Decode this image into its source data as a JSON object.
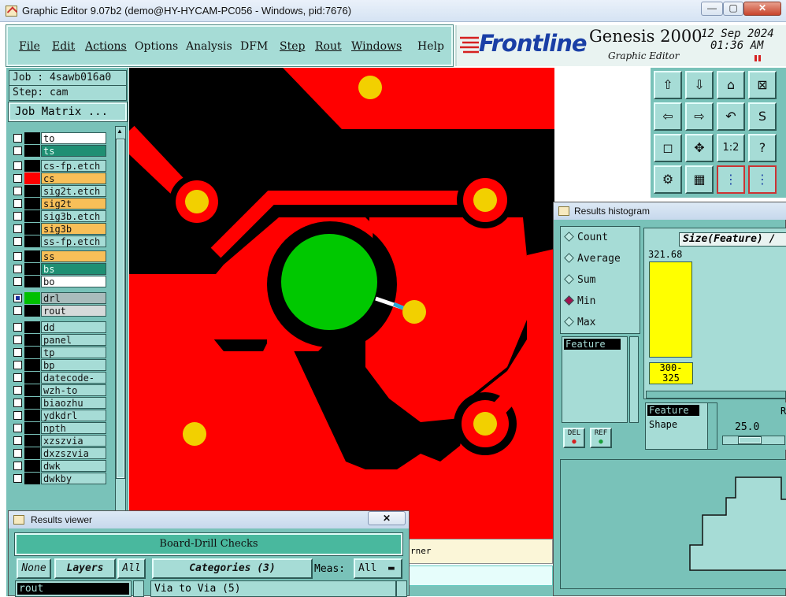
{
  "window": {
    "title": "Graphic Editor 9.07b2 (demo@HY-HYCAM-PC056 - Windows, pid:7676)",
    "min": "—",
    "max": "▢",
    "close": "✕"
  },
  "menu": [
    "File",
    "Edit",
    "Actions",
    "Options",
    "Analysis",
    "DFM",
    "Step",
    "Rout",
    "Windows",
    "Help"
  ],
  "brand": {
    "logo": "Frontline",
    "product": "Genesis 2000",
    "subtitle": "Graphic Editor",
    "date": "12 Sep 2024",
    "time": "01:36 AM"
  },
  "job": {
    "job_label": "Job : 4sawb016a0",
    "step_label": "Step: cam",
    "matrix_button": "Job Matrix ..."
  },
  "layers": [
    {
      "name": "to",
      "color": "#ffffff",
      "swatch": "#000000"
    },
    {
      "name": "ts",
      "color": "#1f8f73",
      "swatch": "#000000"
    },
    {
      "name": "cs-fp.etch",
      "color": "#a6dcd6",
      "swatch": "#000000"
    },
    {
      "name": "cs",
      "color": "#f8bf58",
      "swatch": "#ff0000"
    },
    {
      "name": "sig2t.etch",
      "color": "#a6dcd6",
      "swatch": "#000000"
    },
    {
      "name": "sig2t",
      "color": "#f8bf58",
      "swatch": "#000000"
    },
    {
      "name": "sig3b.etch",
      "color": "#a6dcd6",
      "swatch": "#000000"
    },
    {
      "name": "sig3b",
      "color": "#f8bf58",
      "swatch": "#000000"
    },
    {
      "name": "ss-fp.etch",
      "color": "#a6dcd6",
      "swatch": "#000000"
    },
    {
      "name": "ss",
      "color": "#f8bf58",
      "swatch": "#000000"
    },
    {
      "name": "bs",
      "color": "#1f8f73",
      "swatch": "#000000"
    },
    {
      "name": "bo",
      "color": "#ffffff",
      "swatch": "#000000"
    },
    {
      "name": "drl",
      "color": "#a9bcbc",
      "swatch": "#00c000"
    },
    {
      "name": "rout",
      "color": "#d6dada",
      "swatch": "#000000"
    },
    {
      "name": "dd",
      "color": "#a6dcd6",
      "swatch": "#000000"
    },
    {
      "name": "panel",
      "color": "#a6dcd6",
      "swatch": "#000000"
    },
    {
      "name": "tp",
      "color": "#a6dcd6",
      "swatch": "#000000"
    },
    {
      "name": "bp",
      "color": "#a6dcd6",
      "swatch": "#000000"
    },
    {
      "name": "datecode-to",
      "color": "#a6dcd6",
      "swatch": "#000000"
    },
    {
      "name": "wzh-to",
      "color": "#a6dcd6",
      "swatch": "#000000"
    },
    {
      "name": "biaozhu",
      "color": "#a6dcd6",
      "swatch": "#000000"
    },
    {
      "name": "ydkdrl",
      "color": "#a6dcd6",
      "swatch": "#000000"
    },
    {
      "name": "npth",
      "color": "#a6dcd6",
      "swatch": "#000000"
    },
    {
      "name": "xzszvia",
      "color": "#a6dcd6",
      "swatch": "#000000"
    },
    {
      "name": "dxzszvia",
      "color": "#a6dcd6",
      "swatch": "#000000"
    },
    {
      "name": "dwk",
      "color": "#a6dcd6",
      "swatch": "#000000"
    },
    {
      "name": "dwkby",
      "color": "#a6dcd6",
      "swatch": "#000000"
    }
  ],
  "histogram": {
    "title": "Results histogram",
    "options": [
      "Count",
      "Average",
      "Sum",
      "Min",
      "Max"
    ],
    "selected": "Min",
    "axis_label": "Size(Feature) /",
    "bar_value": "321.68",
    "bar_range": "300-\n325",
    "list_header": "Feature",
    "del_label": "DEL",
    "ref_label": "REF",
    "attr_selected": "Feature",
    "attr_other": "Shape",
    "slider_value": "25.0",
    "slider_label": "R"
  },
  "results_viewer": {
    "title": "Results viewer",
    "check_name": "Board-Drill Checks",
    "none_btn": "None",
    "layers_btn": "Layers",
    "all_btn": "All",
    "categories_btn": "Categories (3)",
    "meas_label": "Meas:",
    "meas_value": "All",
    "layer_item": "rout",
    "category_item": "Via to Via  (5)",
    "partial_text": "rner"
  },
  "toolbar": {
    "zoom_label": "1:2",
    "help_label": "?"
  }
}
